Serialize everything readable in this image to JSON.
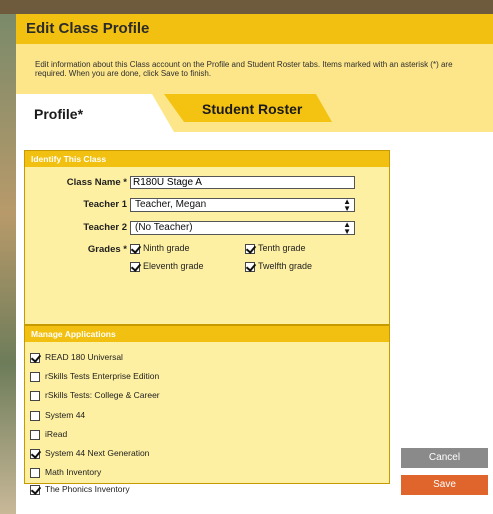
{
  "dialog": {
    "title": "Edit Class Profile",
    "info": "Edit information about this Class account on the Profile and Student Roster tabs. Items marked with an asterisk (*) are required. When you are done, click Save to finish."
  },
  "tabs": [
    {
      "label": "Profile*",
      "active": true
    },
    {
      "label": "Student Roster",
      "active": false
    }
  ],
  "identify": {
    "header": "Identify This Class",
    "class_name_label": "Class Name *",
    "class_name_value": "R180U Stage A",
    "teacher1_label": "Teacher 1",
    "teacher1_value": "Teacher, Megan",
    "teacher2_label": "Teacher 2",
    "teacher2_value": "(No Teacher)",
    "grades_label": "Grades *",
    "grades": [
      {
        "label": "Ninth grade",
        "checked": true
      },
      {
        "label": "Tenth grade",
        "checked": true
      },
      {
        "label": "Eleventh grade",
        "checked": true
      },
      {
        "label": "Twelfth grade",
        "checked": true
      }
    ]
  },
  "applications": {
    "header": "Manage Applications",
    "items": [
      {
        "label": "READ 180 Universal",
        "checked": true
      },
      {
        "label": "rSkills Tests Enterprise Edition",
        "checked": false
      },
      {
        "label": "rSkills Tests: College & Career",
        "checked": false
      },
      {
        "label": "System 44",
        "checked": false
      },
      {
        "label": "iRead",
        "checked": false
      },
      {
        "label": "System 44 Next Generation",
        "checked": true
      },
      {
        "label": "Math Inventory",
        "checked": false
      },
      {
        "label": "The Phonics Inventory",
        "checked": true
      }
    ]
  },
  "buttons": {
    "cancel": "Cancel",
    "save": "Save"
  },
  "colors": {
    "title_bar": "#f2c010",
    "info_bar": "#fde68a",
    "panel": "#fdf0a3",
    "save_button": "#e0652c",
    "cancel_button": "#8a8a8a"
  }
}
